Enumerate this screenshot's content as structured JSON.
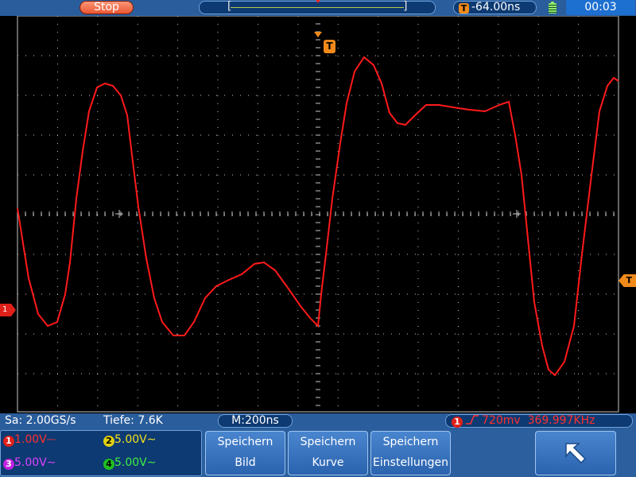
{
  "topbar": {
    "run_state": "Stop",
    "scroll_left_bracket": "[",
    "scroll_right_bracket": "]",
    "trigger_badge": "T",
    "trigger_position": "-64.00ns",
    "battery_icon": "battery-icon",
    "clock": "00:03"
  },
  "screen": {
    "trigger_marker": "T",
    "ch1_marker": "1",
    "trigger_level_marker": "T",
    "trace_color": "#ff1a1a",
    "grid_color": "#c8c8c8"
  },
  "status": {
    "sample_rate": "Sa: 2.00GS/s",
    "depth": "Tiefe: 7.6K",
    "timebase": "M:200ns",
    "trigger_channel": "1",
    "trigger_level": "720mv",
    "frequency": "369.997KHz"
  },
  "channels": [
    {
      "num": "1",
      "value": "1.00V",
      "coupling": "⎓",
      "color": "#ff3030"
    },
    {
      "num": "2",
      "value": "5.00V",
      "coupling": "∼",
      "color": "#f0e020"
    },
    {
      "num": "3",
      "value": "5.00V",
      "coupling": "∼",
      "color": "#e040ff"
    },
    {
      "num": "4",
      "value": "5.00V",
      "coupling": "∼",
      "color": "#40f040"
    }
  ],
  "softkeys": [
    {
      "line1": "Speichern",
      "line2": "Bild"
    },
    {
      "line1": "Speichern",
      "line2": "Kurve"
    },
    {
      "line1": "Speichern",
      "line2": "Einstellungen"
    }
  ],
  "back_icon": "back-arrow-icon"
}
